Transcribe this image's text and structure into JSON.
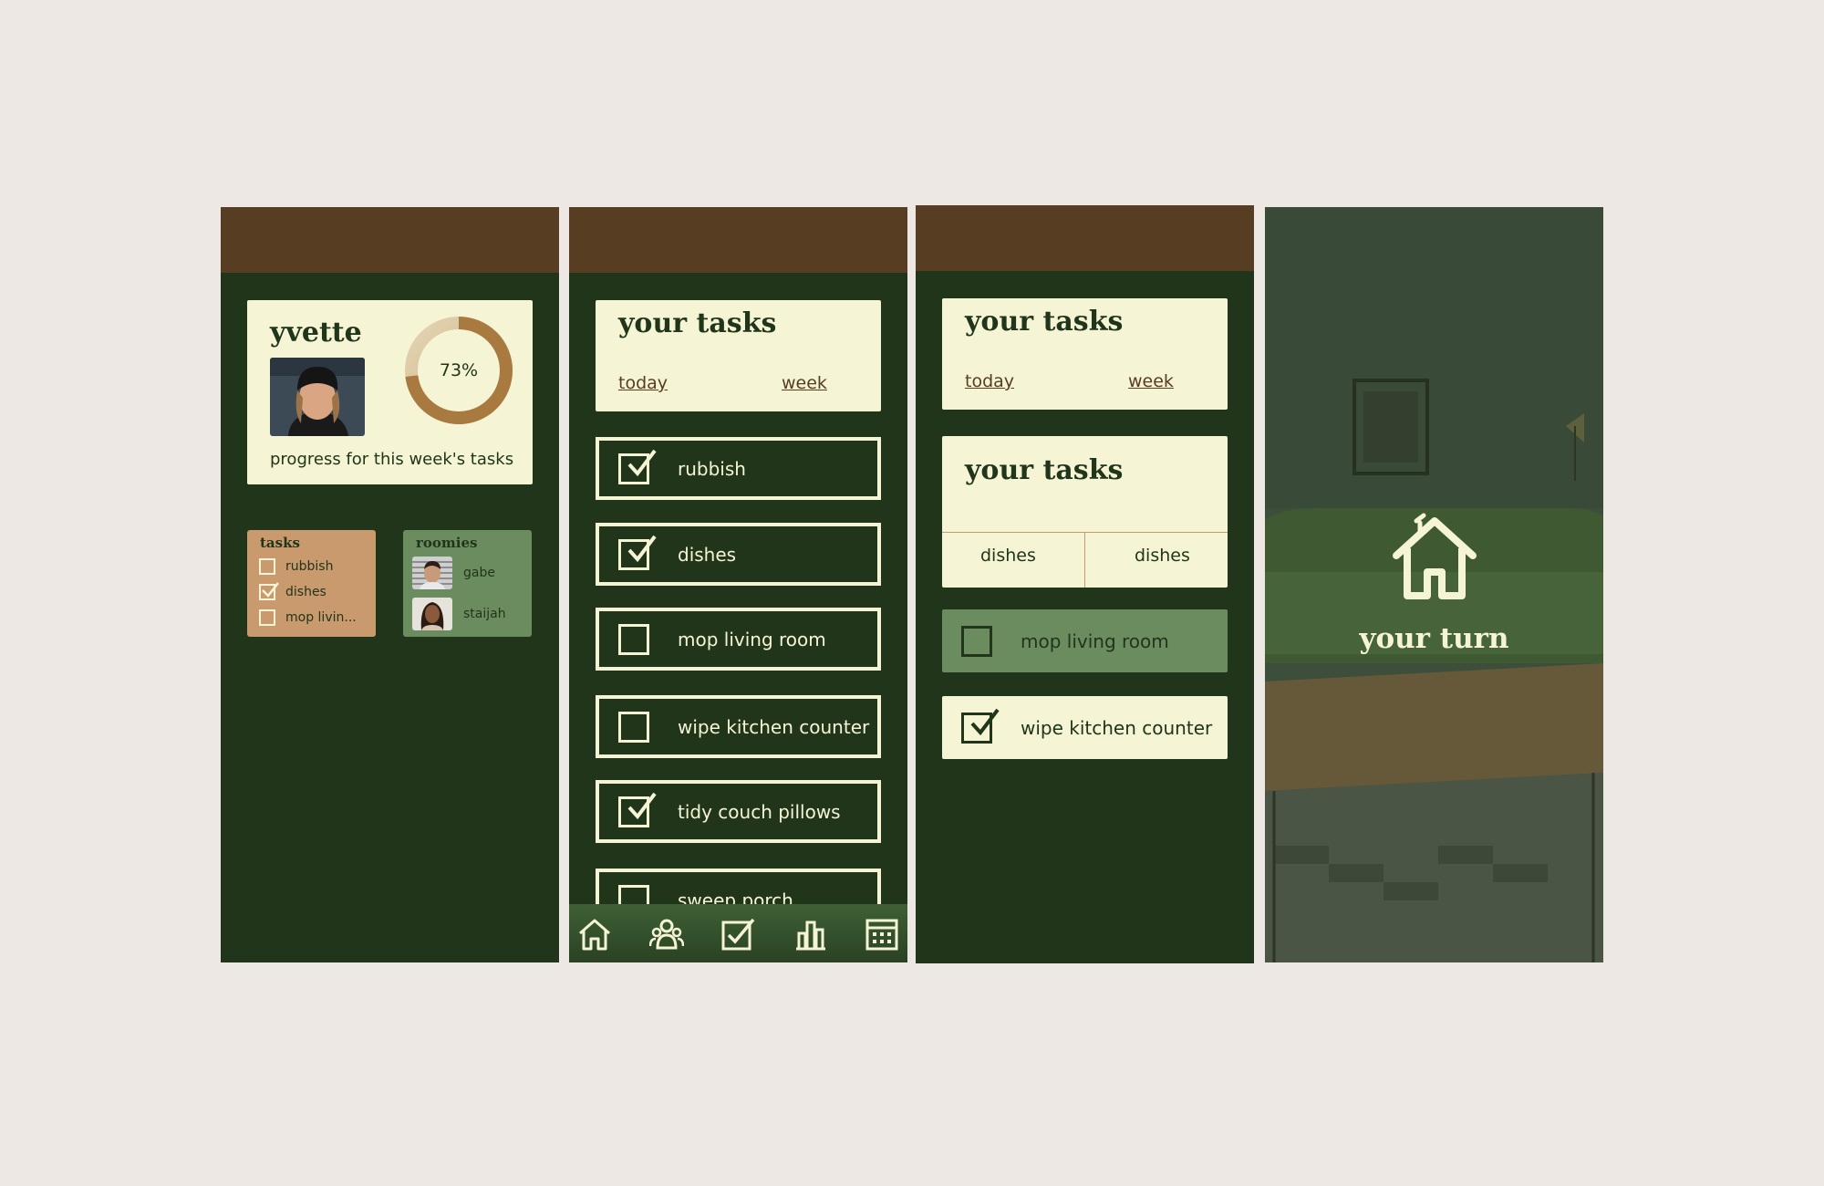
{
  "colors": {
    "background": "#ede8e3",
    "dark_green": "#21351b",
    "brown": "#573d22",
    "cream": "#f5f5d5",
    "tan": "#c99a6d",
    "sage": "#6b8c5f"
  },
  "profile": {
    "name": "yvette",
    "progress": 0.73,
    "progress_label": "73%",
    "caption": "progress for this week's tasks"
  },
  "mini_tasks": {
    "title": "tasks",
    "items": [
      {
        "label": "rubbish",
        "checked": false
      },
      {
        "label": "dishes",
        "checked": true
      },
      {
        "label": "mop livin...",
        "checked": false
      }
    ]
  },
  "roomies": {
    "title": "roomies",
    "items": [
      {
        "name": "gabe"
      },
      {
        "name": "staijah"
      }
    ]
  },
  "task_list": {
    "title": "your tasks",
    "tabs": [
      "today",
      "week"
    ],
    "items": [
      {
        "label": "rubbish",
        "checked": true
      },
      {
        "label": "dishes",
        "checked": true
      },
      {
        "label": "mop living room",
        "checked": false
      },
      {
        "label": "wipe kitchen counter",
        "checked": false
      },
      {
        "label": "tidy couch pillows",
        "checked": true
      },
      {
        "label": "sweep porch",
        "checked": false
      }
    ]
  },
  "nav": [
    "home-icon",
    "roommates-icon",
    "tasks-icon",
    "stats-icon",
    "calendar-icon"
  ],
  "screen3": {
    "title": "your tasks",
    "tabs": [
      "today",
      "week"
    ],
    "second_title": "your tasks",
    "split": [
      "dishes",
      "dishes"
    ],
    "items": [
      {
        "label": "mop living room",
        "checked": false
      },
      {
        "label": "wipe kitchen counter",
        "checked": true
      }
    ]
  },
  "splash": {
    "title": "your turn"
  }
}
